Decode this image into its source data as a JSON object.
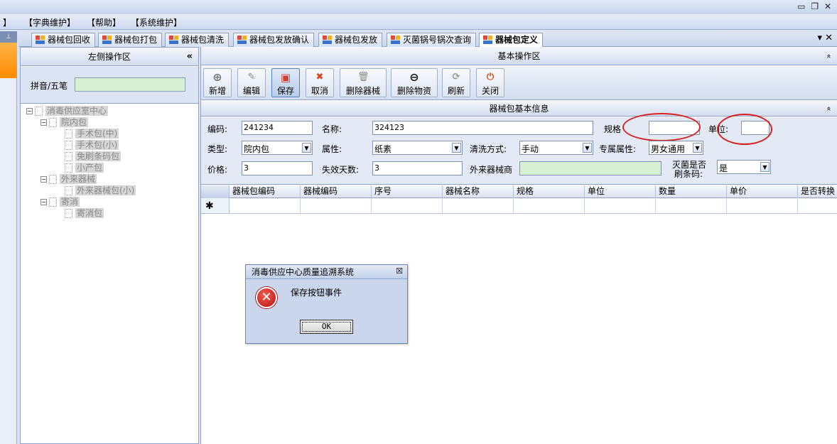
{
  "window": {
    "controls": "▭ ❐ ✕"
  },
  "menu": [
    "】",
    "【字典维护】",
    "【帮助】",
    "【系统维护】"
  ],
  "tabs": [
    {
      "label": "器械包回收"
    },
    {
      "label": "器械包打包"
    },
    {
      "label": "器械包清洗"
    },
    {
      "label": "器械包发放确认"
    },
    {
      "label": "器械包发放"
    },
    {
      "label": "灭菌锅号锅次查询"
    },
    {
      "label": "器械包定义"
    }
  ],
  "tab_controls": "▾ ✕",
  "left_pane": {
    "title": "左侧操作区",
    "collapse": "«",
    "search_label": "拼音/五笔",
    "search_value": "",
    "tree": [
      {
        "label": "消毒供应室中心",
        "level": 0,
        "expand": "−"
      },
      {
        "label": "院内包",
        "level": 1,
        "expand": "−"
      },
      {
        "label": "手术包(中)",
        "level": 2
      },
      {
        "label": "手术包(小)",
        "level": 2
      },
      {
        "label": "免刷条码包",
        "level": 2
      },
      {
        "label": "小产包",
        "level": 2
      },
      {
        "label": "外来器械",
        "level": 1,
        "expand": "−"
      },
      {
        "label": "外来器械包(小)",
        "level": 2
      },
      {
        "label": "寄消",
        "level": 1,
        "expand": "−"
      },
      {
        "label": "寄消包",
        "level": 2
      }
    ]
  },
  "right_pane": {
    "title": "基本操作区",
    "collapse": "»",
    "toolbar": [
      {
        "label": "新增",
        "icon": "plus-icon",
        "glyph": "⊕"
      },
      {
        "label": "编辑",
        "icon": "pencil-icon",
        "glyph": "✎"
      },
      {
        "label": "保存",
        "icon": "save-icon",
        "glyph": "▣"
      },
      {
        "label": "取消",
        "icon": "cancel-icon",
        "glyph": "✖"
      },
      {
        "label": "删除器械",
        "icon": "trash-icon",
        "glyph": "🗑"
      },
      {
        "label": "删除物资",
        "icon": "minus-circle-icon",
        "glyph": "⊖"
      },
      {
        "label": "刷新",
        "icon": "refresh-icon",
        "glyph": "⟳"
      },
      {
        "label": "关闭",
        "icon": "power-icon",
        "glyph": "⏻"
      }
    ],
    "info_title": "器械包基本信息",
    "info_collapse": "»",
    "form": {
      "code_label": "编码:",
      "code_value": "241234",
      "name_label": "名称:",
      "name_value": "324123",
      "spec_label": "规格",
      "spec_value": "",
      "unit_label": "单位:",
      "unit_value": "",
      "type_label": "类型:",
      "type_value": "院内包",
      "attr_label": "属性:",
      "attr_value": "纸素",
      "wash_label": "清洗方式:",
      "wash_value": "手动",
      "exclusive_label": "专属属性:",
      "exclusive_value": "男女通用",
      "price_label": "价格:",
      "price_value": "3",
      "expire_label": "失效天数:",
      "expire_value": "3",
      "vendor_label": "外来器械商",
      "vendor_value": "",
      "sterilize_label_1": "灭菌是否",
      "sterilize_label_2": "刷条码:",
      "sterilize_value": "是"
    },
    "grid": {
      "columns": [
        "器械包编码",
        "器械编码",
        "序号",
        "器械名称",
        "规格",
        "单位",
        "数量",
        "单价",
        "是否转换"
      ],
      "new_row_marker": "✱"
    }
  },
  "dialog": {
    "title": "消毒供应中心质量追溯系统",
    "close": "☒",
    "icon_glyph": "✕",
    "message": "保存按钮事件",
    "ok_label": "OK"
  }
}
